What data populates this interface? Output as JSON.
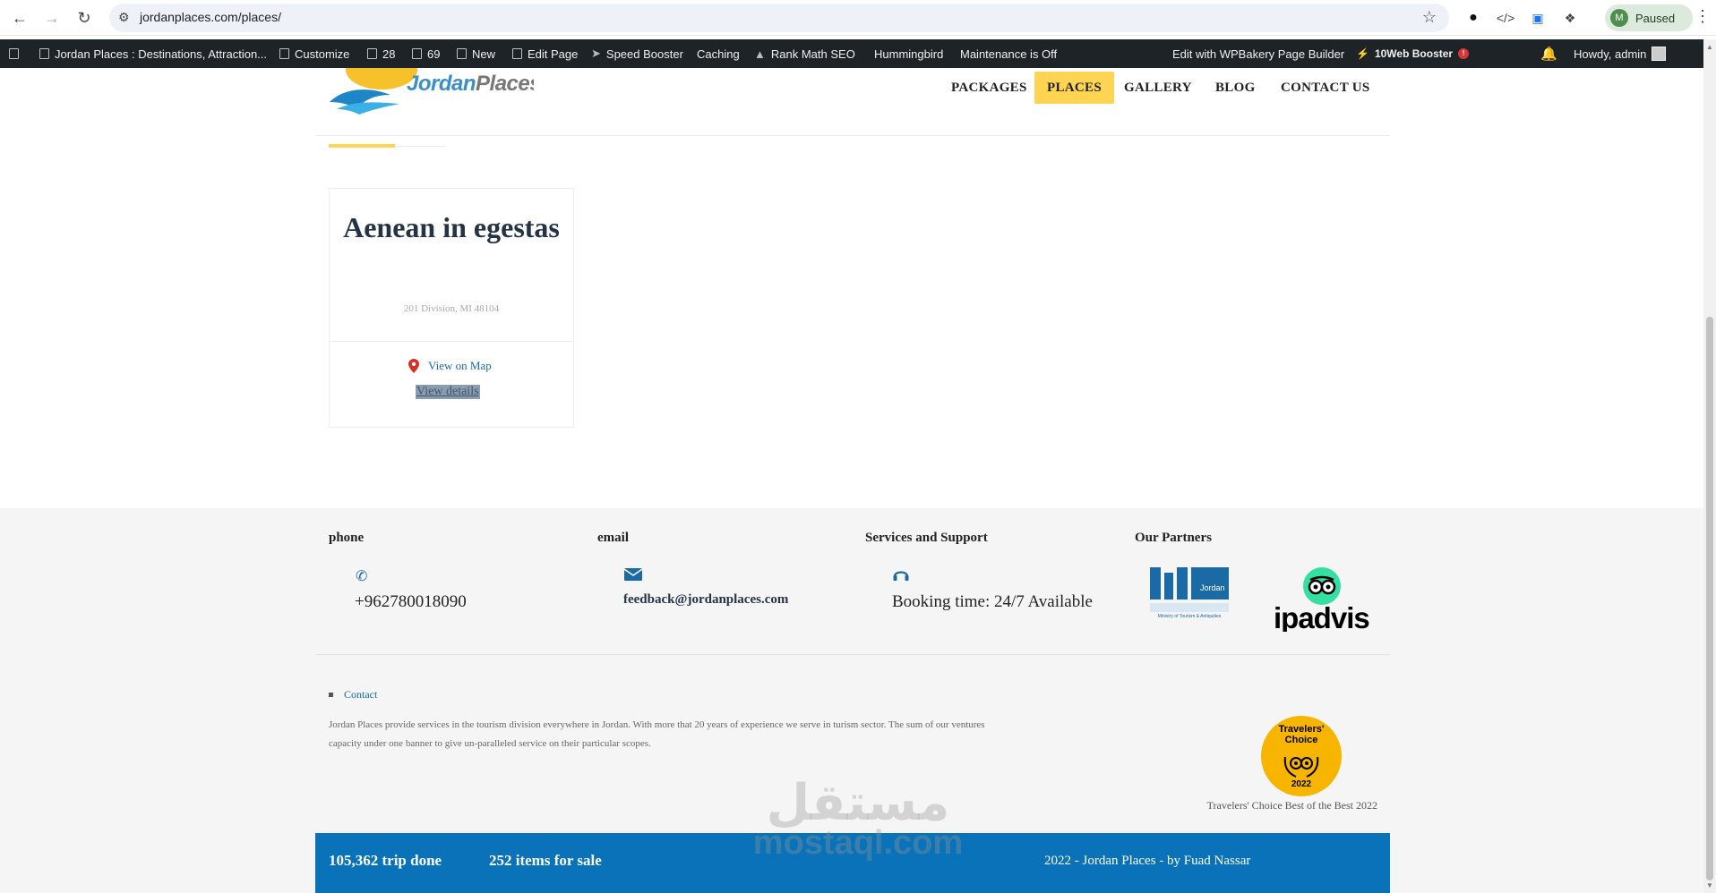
{
  "browser": {
    "url": "jordanplaces.com/places/",
    "profile_initial": "M",
    "profile_status": "Paused"
  },
  "adminbar": {
    "site_name": "Jordan Places : Destinations, Attraction...",
    "customize": "Customize",
    "updates_count": "28",
    "comments_count": "69",
    "new": "New",
    "edit_page": "Edit Page",
    "speed_booster": "Speed Booster",
    "caching": "Caching",
    "rank_math": "Rank Math SEO",
    "hummingbird": "Hummingbird",
    "maintenance": "Maintenance is Off",
    "wpbakery": "Edit with WPBakery Page Builder",
    "tenweb": "10Web Booster",
    "tenweb_badge": "!",
    "greeting": "Howdy, admin"
  },
  "site": {
    "logo_text_a": "Jordan",
    "logo_text_b": "Places",
    "nav": {
      "packages": "PACKAGES",
      "places": "PLACES",
      "gallery": "GALLERY",
      "blog": "BLOG",
      "contact": "CONTACT US"
    },
    "accent_color": "#ffd452"
  },
  "place_card": {
    "title": "Aenean in egestas",
    "address": "201 Division, MI 48104",
    "view_map": "View on Map",
    "view_details": "View details"
  },
  "footer": {
    "phone_heading": "phone",
    "phone_value": "+962780018090",
    "email_heading": "email",
    "email_value": "feedback@jordanplaces.com",
    "services_heading": "Services and Support",
    "services_value": "Booking time: 24/7 Available",
    "partners_heading": "Our Partners",
    "partner_mota_latin": "Jordan",
    "partner_mota_caption": "Ministry of Tourism & Antiquities",
    "partner_tripadvisor": "ipadvisor",
    "contact_link": "Contact",
    "about": "Jordan Places provide services in the tourism division everywhere in Jordan. With more that 20 years of experience we serve in turism sector. The sum of our ventures capacity under one banner to give un-paralleled service on their particular scopes.",
    "badge_text": "Travelers' Choice",
    "badge_year": "2022",
    "badge_caption": "Travelers' Choice Best of the Best 2022",
    "trips_done": "105,362 trip done",
    "items_for_sale": "252 items for sale",
    "copyright": "2022 - Jordan Places - by Fuad Nassar",
    "bar_color": "#0a72b8"
  },
  "watermark": {
    "arabic": "مستقل",
    "latin": "mostaql.com"
  }
}
